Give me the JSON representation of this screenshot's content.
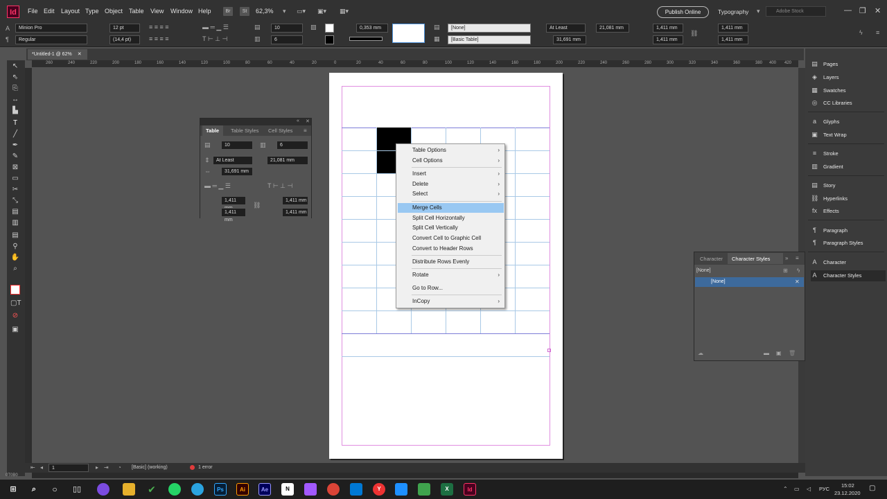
{
  "menubar": {
    "logo": "Id",
    "items": [
      "File",
      "Edit",
      "Layout",
      "Type",
      "Object",
      "Table",
      "View",
      "Window",
      "Help"
    ],
    "bridge": "Br",
    "stock_badge": "St",
    "zoom": "62,3%",
    "publish": "Publish Online",
    "workspace": "Typography",
    "search_placeholder": "Adobe Stock"
  },
  "control": {
    "font": "Minion Pro",
    "style": "Regular",
    "size": "12 pt",
    "leading": "(14,4 pt)",
    "rows": "10",
    "cols": "6",
    "stroke": "0,353 mm",
    "cell_style": "[None]",
    "table_style": "[Basic Table]",
    "row_height_mode": "At Least",
    "row_height": "21,081 mm",
    "col_width": "31,691 mm",
    "inset_top": "1,411 mm",
    "inset_bottom": "1,411 mm",
    "inset_left": "1,411 mm",
    "inset_right": "1,411 mm"
  },
  "document_tab": "*Untitled-1 @ 62%",
  "ruler_ticks": [
    "260",
    "240",
    "220",
    "200",
    "180",
    "160",
    "140",
    "120",
    "100",
    "80",
    "60",
    "40",
    "20",
    "0",
    "20",
    "40",
    "60",
    "80",
    "100",
    "120",
    "140",
    "160",
    "180",
    "200",
    "220",
    "240",
    "260",
    "280",
    "300",
    "320",
    "340",
    "360",
    "380",
    "400",
    "420"
  ],
  "table_panel": {
    "tabs": [
      "Table",
      "Table Styles",
      "Cell Styles"
    ],
    "rows": "10",
    "cols": "6",
    "row_mode": "At Least",
    "row_height": "21,081 mm",
    "col_width": "31,691 mm",
    "inset_top": "1,411 mm",
    "inset_left": "1,411 mm",
    "inset_bottom": "1,411 mm",
    "inset_right": "1,411 mm"
  },
  "context_menu": {
    "items": [
      {
        "label": "Table Options",
        "sub": true
      },
      {
        "label": "Cell Options",
        "sub": true
      },
      {
        "label": "Insert",
        "sub": true
      },
      {
        "label": "Delete",
        "sub": true
      },
      {
        "label": "Select",
        "sub": true
      },
      {
        "label": "Merge Cells",
        "sub": false,
        "highlight": true
      },
      {
        "label": "Split Cell Horizontally",
        "sub": false
      },
      {
        "label": "Split Cell Vertically",
        "sub": false
      },
      {
        "label": "Convert Cell to Graphic Cell",
        "sub": false
      },
      {
        "label": "Convert to Header Rows",
        "sub": false
      },
      {
        "label": "Distribute Rows Evenly",
        "sub": false
      },
      {
        "label": "Rotate",
        "sub": true
      },
      {
        "label": "Go to Row...",
        "sub": false
      },
      {
        "label": "InCopy",
        "sub": true
      }
    ]
  },
  "dock": {
    "items": [
      "Pages",
      "Layers",
      "Swatches",
      "CC Libraries",
      "Glyphs",
      "Text Wrap",
      "Stroke",
      "Gradient",
      "Story",
      "Hyperlinks",
      "Effects",
      "Paragraph",
      "Paragraph Styles",
      "Character",
      "Character Styles"
    ]
  },
  "char_panel": {
    "tabs": [
      "Character",
      "Character Styles"
    ],
    "current": "[None]",
    "selected_item": "[None]"
  },
  "status": {
    "page": "1",
    "style": "[Basic] (working)",
    "errors": "1 error"
  },
  "coord_readout": "0T0B0",
  "taskbar": {
    "lang": "РУС",
    "time": "15:02",
    "date": "23.12.2020"
  }
}
